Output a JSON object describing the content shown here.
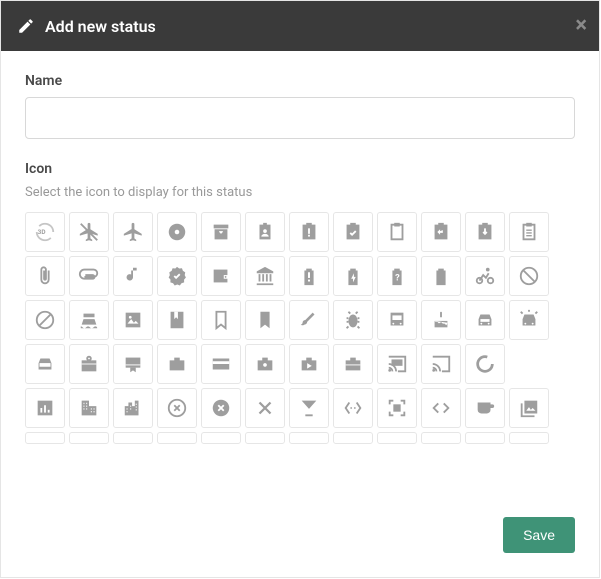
{
  "header": {
    "title": "Add new status"
  },
  "fields": {
    "name_label": "Name",
    "name_value": "",
    "icon_label": "Icon",
    "icon_hint": "Select the icon to display for this status"
  },
  "footer": {
    "save_label": "Save"
  },
  "icons": [
    [
      "3d-rotation",
      "airplanemode-off",
      "airplane",
      "album",
      "archive",
      "badge",
      "assignment-late",
      "assignment-check",
      "clipboard",
      "assignment-return",
      "assignment-down",
      "clipboard-list"
    ],
    [
      "attach-file",
      "attachment",
      "music-note",
      "verified",
      "wallet",
      "account-balance",
      "battery-alert",
      "battery-charging",
      "battery-unknown",
      "battery-full",
      "bike",
      "block"
    ],
    [
      "block-outline",
      "boat",
      "image",
      "book",
      "bookmark-outline",
      "bookmark",
      "brush",
      "bug",
      "bus",
      "cake",
      "car",
      "car-lights"
    ],
    [
      "directions-car",
      "card-giftcard",
      "card-membership",
      "briefcase",
      "credit-card",
      "shopping-briefcase",
      "play-briefcase",
      "work-briefcase",
      "cast-connected",
      "cast",
      "circle-notch",
      ""
    ],
    [
      "bar-chart",
      "business",
      "city",
      "cancel-outline",
      "cancel",
      "close",
      "cocktail",
      "code-braces",
      "fullscreen",
      "code",
      "coffee",
      "collections"
    ]
  ]
}
